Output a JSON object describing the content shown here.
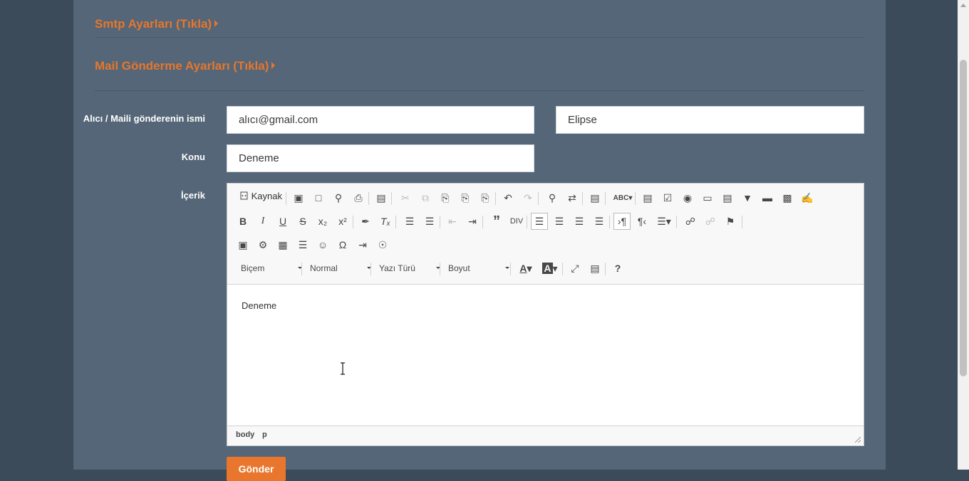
{
  "sections": {
    "smtp_link": "Smtp Ayarları (Tıkla)",
    "mail_link": "Mail Gönderme Ayarları (Tıkla)"
  },
  "form": {
    "recipient_label": "Alıcı / Maili gönderenin ismi",
    "recipient_email": "alıcı@gmail.com",
    "sender_name": "Elipse",
    "subject_label": "Konu",
    "subject_value": "Deneme",
    "content_label": "İçerik",
    "submit_label": "Gönder"
  },
  "editor": {
    "source_label": "Kaynak",
    "format_combo": "Biçem",
    "style_combo": "Normal",
    "font_combo": "Yazı Türü",
    "size_combo": "Boyut",
    "content_text": "Deneme",
    "path": [
      "body",
      "p"
    ]
  },
  "colors": {
    "background": "#3b4b5a",
    "panel": "#546677",
    "accent": "#e8762c"
  }
}
